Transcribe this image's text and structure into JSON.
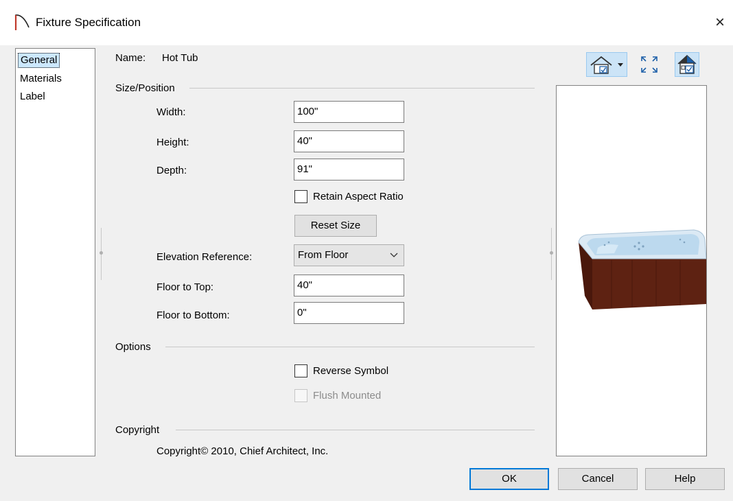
{
  "window": {
    "title": "Fixture Specification",
    "close_glyph": "×"
  },
  "nav": {
    "items": [
      "General",
      "Materials",
      "Label"
    ],
    "selected": "General"
  },
  "general": {
    "name_label": "Name:",
    "name_value": "Hot Tub",
    "size_position": {
      "heading": "Size/Position",
      "width_label": "Width:",
      "width_value": "100\"",
      "height_label": "Height:",
      "height_value": "40\"",
      "depth_label": "Depth:",
      "depth_value": "91\"",
      "retain_aspect_label": "Retain Aspect Ratio",
      "retain_aspect_checked": false,
      "reset_size_label": "Reset Size",
      "elevation_ref_label": "Elevation Reference:",
      "elevation_ref_value": "From Floor",
      "floor_to_top_label": "Floor to Top:",
      "floor_to_top_value": "40\"",
      "floor_to_bottom_label": "Floor to Bottom:",
      "floor_to_bottom_value": "0\""
    },
    "options": {
      "heading": "Options",
      "reverse_symbol_label": "Reverse Symbol",
      "reverse_symbol_checked": false,
      "flush_mounted_label": "Flush Mounted",
      "flush_mounted_checked": false,
      "flush_mounted_enabled": false
    },
    "copyright": {
      "heading": "Copyright",
      "text": "Copyright© 2010, Chief Architect, Inc."
    }
  },
  "preview_toolbar": {
    "icons": [
      "house-view-icon",
      "dropdown-arrow-icon",
      "fit-to-window-icon",
      "render-toggle-icon"
    ]
  },
  "buttons": {
    "ok": "OK",
    "cancel": "Cancel",
    "help": "Help"
  },
  "colors": {
    "accent": "#0078d7",
    "tub_wood": "#5a1f10",
    "tub_water": "#cfe6f5",
    "title_icon": "#c0392b"
  }
}
